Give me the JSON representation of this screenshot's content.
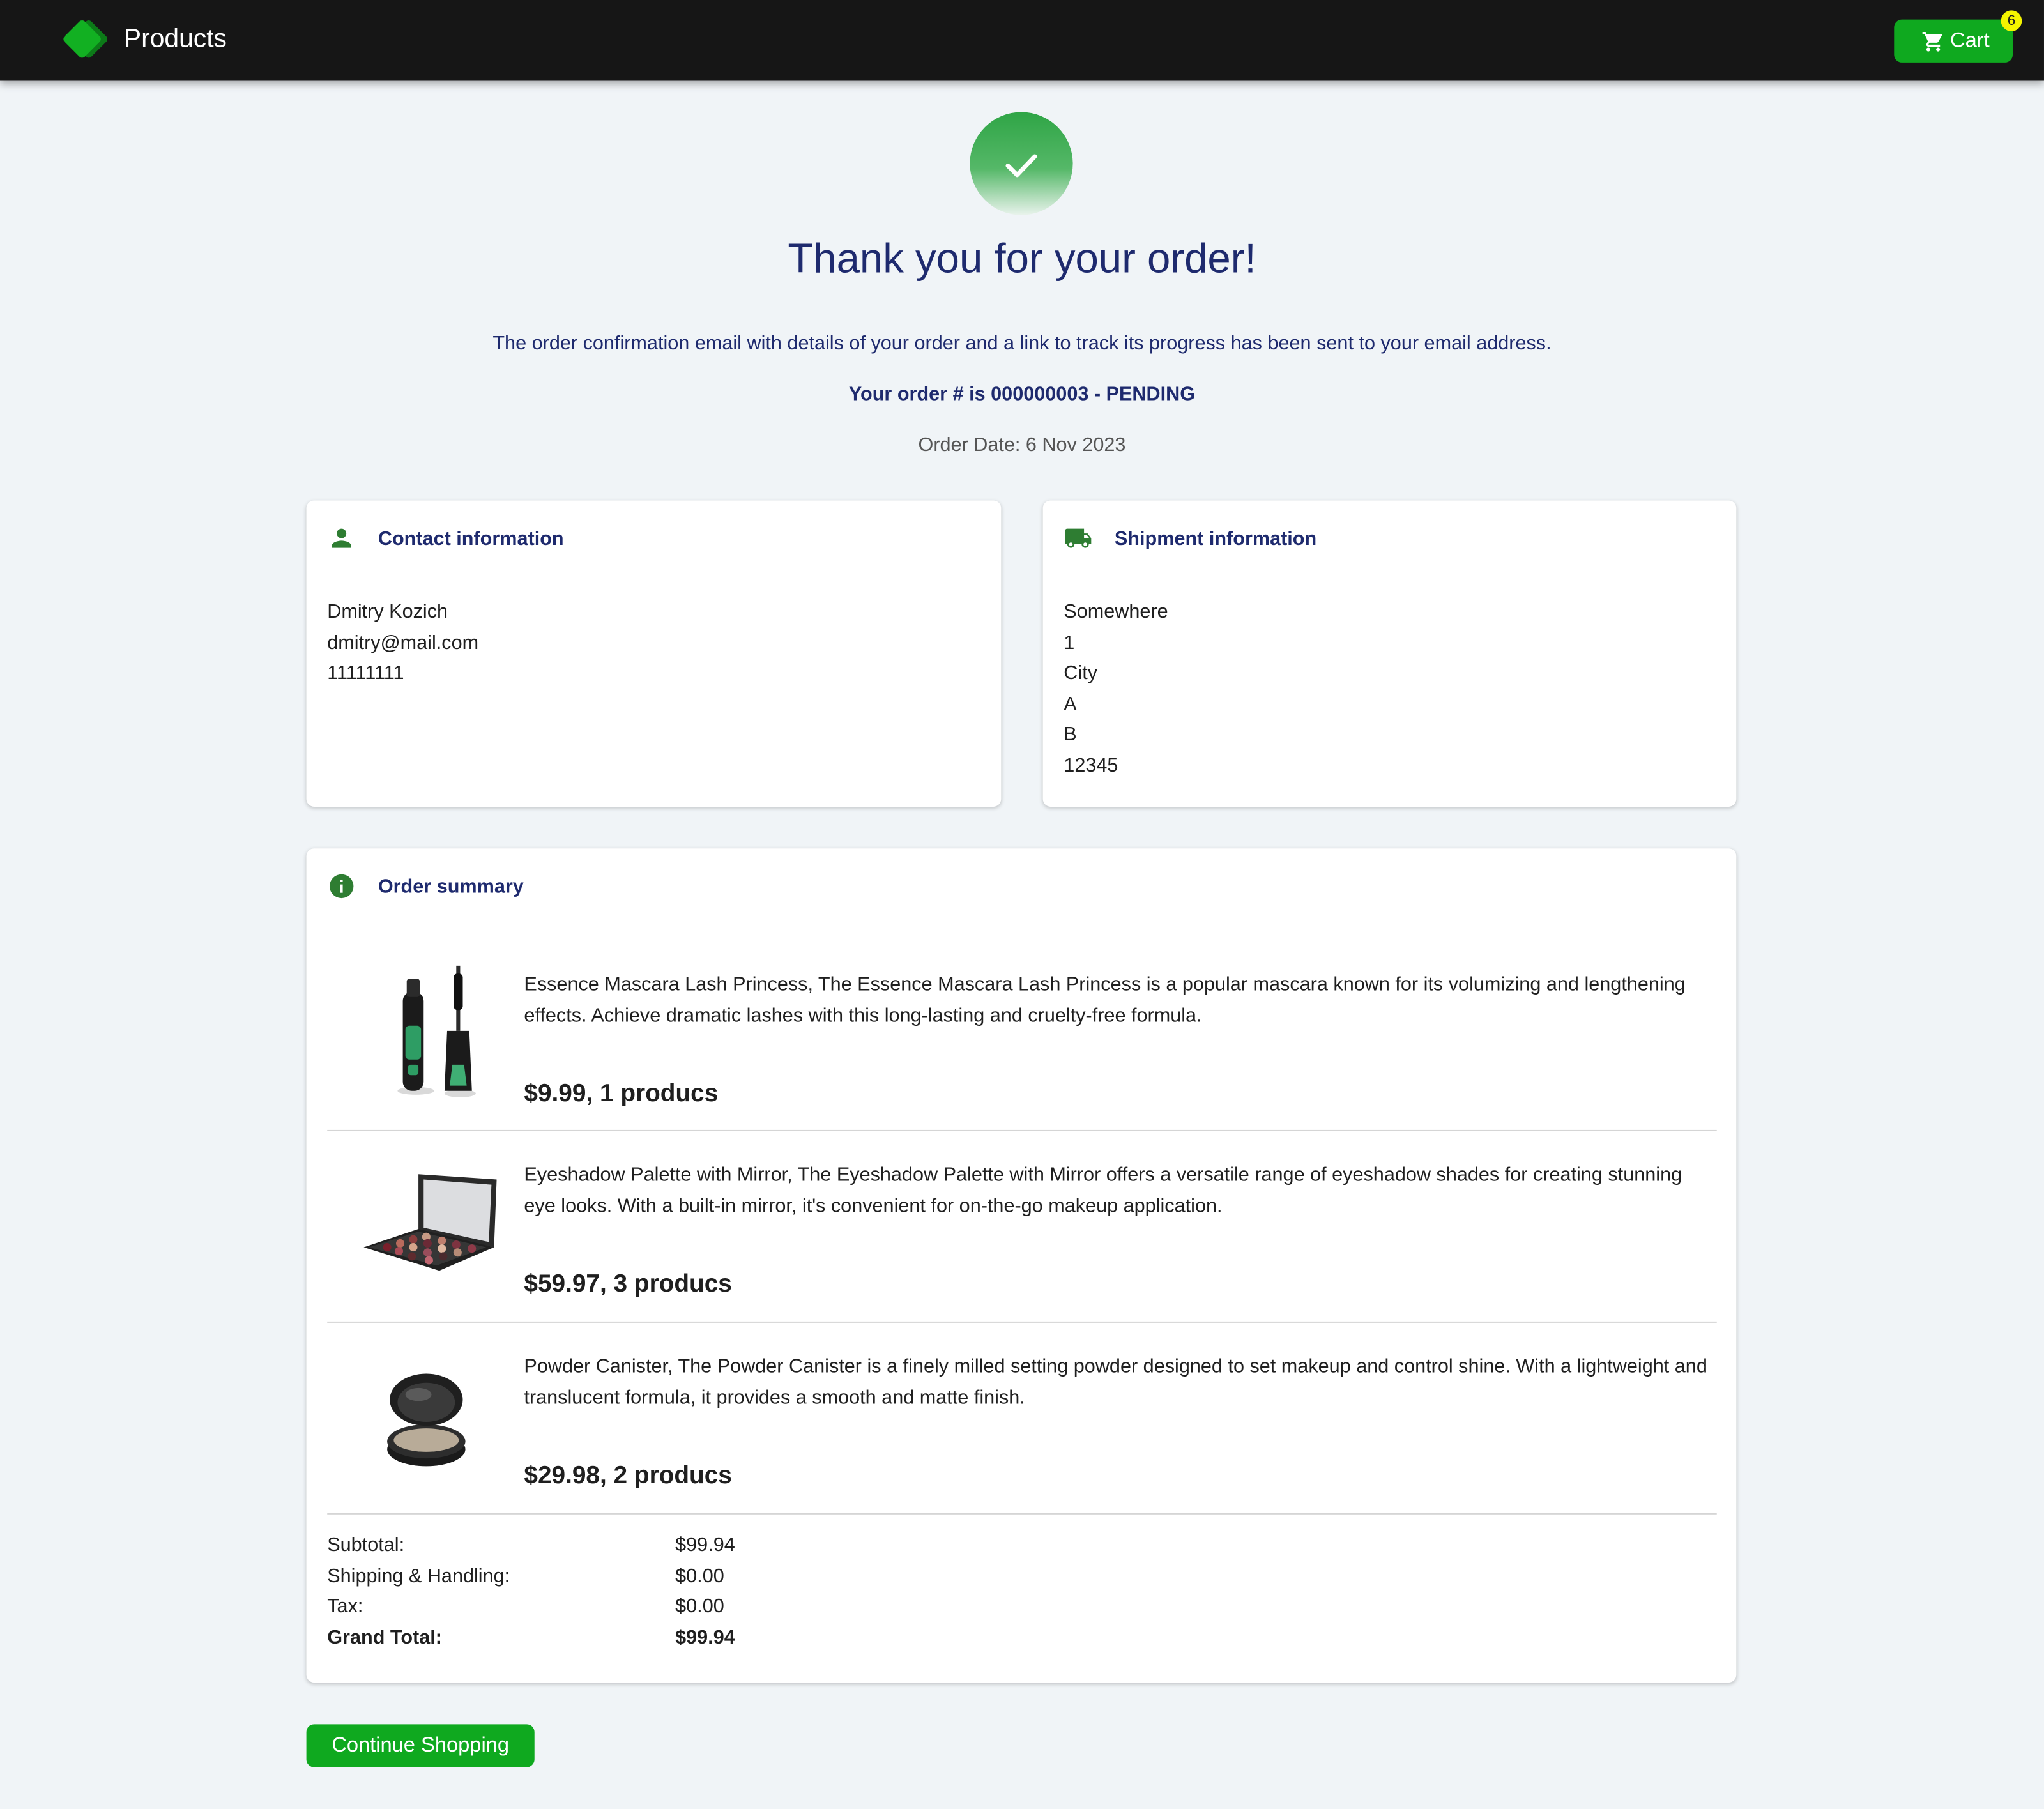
{
  "header": {
    "brand": "Products",
    "cart_label": "Cart",
    "cart_count": "6",
    "colors": {
      "bar": "#161616",
      "accent": "#0fa91f",
      "badge": "#f4f400"
    }
  },
  "confirmation": {
    "icon": "check-icon",
    "title": "Thank you for your order!",
    "message": "The order confirmation email with details of your order and a link to track its progress has been sent to your email address.",
    "order_number": "Your order # is 000000003 - PENDING",
    "order_date": "Order Date: 6 Nov 2023"
  },
  "contact": {
    "title": "Contact information",
    "icon": "person-icon",
    "lines": [
      "Dmitry Kozich",
      "dmitry@mail.com",
      "11111111"
    ]
  },
  "shipment": {
    "title": "Shipment information",
    "icon": "truck-icon",
    "lines": [
      "Somewhere",
      "1",
      "City",
      "A",
      "B",
      "12345"
    ]
  },
  "summary": {
    "title": "Order summary",
    "icon": "info-icon",
    "items": [
      {
        "image": "mascara-product-image",
        "description": "Essence Mascara Lash Princess, The Essence Mascara Lash Princess is a popular mascara known for its volumizing and lengthening effects. Achieve dramatic lashes with this long-lasting and cruelty-free formula.",
        "price_line": "$9.99, 1 producs"
      },
      {
        "image": "eyeshadow-palette-product-image",
        "description": "Eyeshadow Palette with Mirror, The Eyeshadow Palette with Mirror offers a versatile range of eyeshadow shades for creating stunning eye looks. With a built-in mirror, it's convenient for on-the-go makeup application.",
        "price_line": "$59.97, 3 producs"
      },
      {
        "image": "powder-canister-product-image",
        "description": "Powder Canister, The Powder Canister is a finely milled setting powder designed to set makeup and control shine. With a lightweight and translucent formula, it provides a smooth and matte finish.",
        "price_line": "$29.98, 2 producs"
      }
    ],
    "totals": {
      "subtotal_label": "Subtotal:",
      "subtotal_value": "$99.94",
      "shipping_label": "Shipping & Handling:",
      "shipping_value": "$0.00",
      "tax_label": "Tax:",
      "tax_value": "$0.00",
      "grand_label": "Grand Total:",
      "grand_value": "$99.94"
    }
  },
  "actions": {
    "continue_label": "Continue Shopping"
  }
}
